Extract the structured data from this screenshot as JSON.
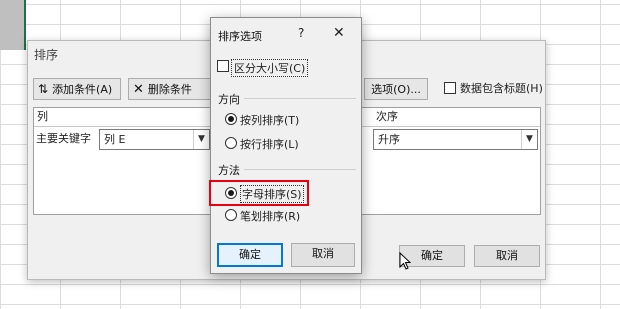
{
  "sort_dialog": {
    "title": "排序",
    "toolbar": {
      "add_condition": "添加条件(A)",
      "delete_condition": "删除条件",
      "options": "选项(O)...",
      "header_checkbox_label": "数据包含标题(H)"
    },
    "columns": {
      "column": "列",
      "order": "次序"
    },
    "row": {
      "label": "主要关键字",
      "column_value": "列 E",
      "order_value": "升序"
    },
    "ok": "确定",
    "cancel": "取消"
  },
  "options_dialog": {
    "title": "排序选项",
    "help": "?",
    "close": "✕",
    "case_sensitive_label": "区分大小写(C)",
    "direction": {
      "label": "方向",
      "by_column": "按列排序(T)",
      "by_row": "按行排序(L)",
      "selected": "by_column"
    },
    "method": {
      "label": "方法",
      "alphabetical": "字母排序(S)",
      "stroke": "笔划排序(R)",
      "selected": "alphabetical"
    },
    "ok": "确定",
    "cancel": "取消"
  },
  "icons": [
    "add-condition-icon",
    "delete-condition-icon",
    "dropdown-arrow-icon",
    "mouse-cursor-icon",
    "help-icon",
    "close-icon"
  ],
  "colors": {
    "highlight": "#e60012",
    "focus": "#0078d7"
  }
}
